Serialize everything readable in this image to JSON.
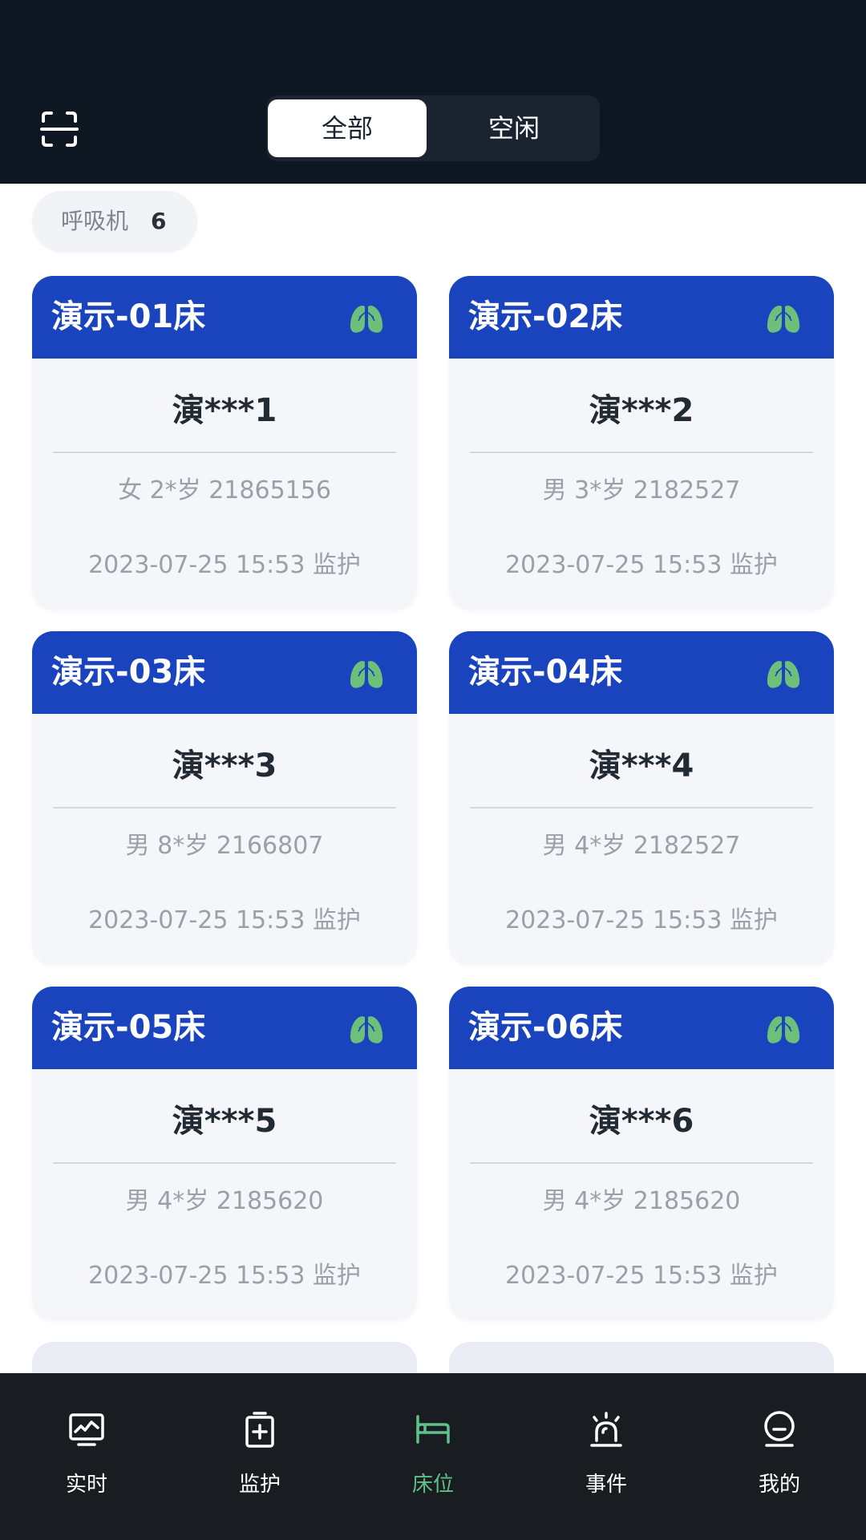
{
  "header": {
    "segments": [
      {
        "label": "全部",
        "active": true
      },
      {
        "label": "空闲",
        "active": false
      }
    ],
    "scan_icon": "scan-icon"
  },
  "filter": {
    "label": "呼吸机",
    "count": "6"
  },
  "beds": [
    {
      "bed": "演示-01床",
      "name": "演***1",
      "info": "女  2*岁  21865156",
      "status": "2023-07-25 15:53  监护",
      "icon": "lung-icon"
    },
    {
      "bed": "演示-02床",
      "name": "演***2",
      "info": "男  3*岁  2182527",
      "status": "2023-07-25 15:53  监护",
      "icon": "lung-icon"
    },
    {
      "bed": "演示-03床",
      "name": "演***3",
      "info": "男  8*岁  2166807",
      "status": "2023-07-25 15:53  监护",
      "icon": "lung-icon"
    },
    {
      "bed": "演示-04床",
      "name": "演***4",
      "info": "男  4*岁  2182527",
      "status": "2023-07-25 15:53  监护",
      "icon": "lung-icon"
    },
    {
      "bed": "演示-05床",
      "name": "演***5",
      "info": "男  4*岁  2185620",
      "status": "2023-07-25 15:53  监护",
      "icon": "lung-icon"
    },
    {
      "bed": "演示-06床",
      "name": "演***6",
      "info": "男  4*岁  2185620",
      "status": "2023-07-25 15:53  监护",
      "icon": "lung-icon"
    }
  ],
  "tabbar": {
    "items": [
      {
        "label": "实时",
        "icon": "monitor-icon"
      },
      {
        "label": "监护",
        "icon": "clipboard-plus-icon"
      },
      {
        "label": "床位",
        "icon": "bed-icon",
        "active": true
      },
      {
        "label": "事件",
        "icon": "alarm-icon"
      },
      {
        "label": "我的",
        "icon": "profile-icon"
      }
    ]
  },
  "colors": {
    "header_bg": "#0c1722",
    "card_header": "#1a44bd",
    "lung_green": "#6cc07a",
    "active_tab": "#5fc08a",
    "tabbar_bg": "#191c21"
  }
}
